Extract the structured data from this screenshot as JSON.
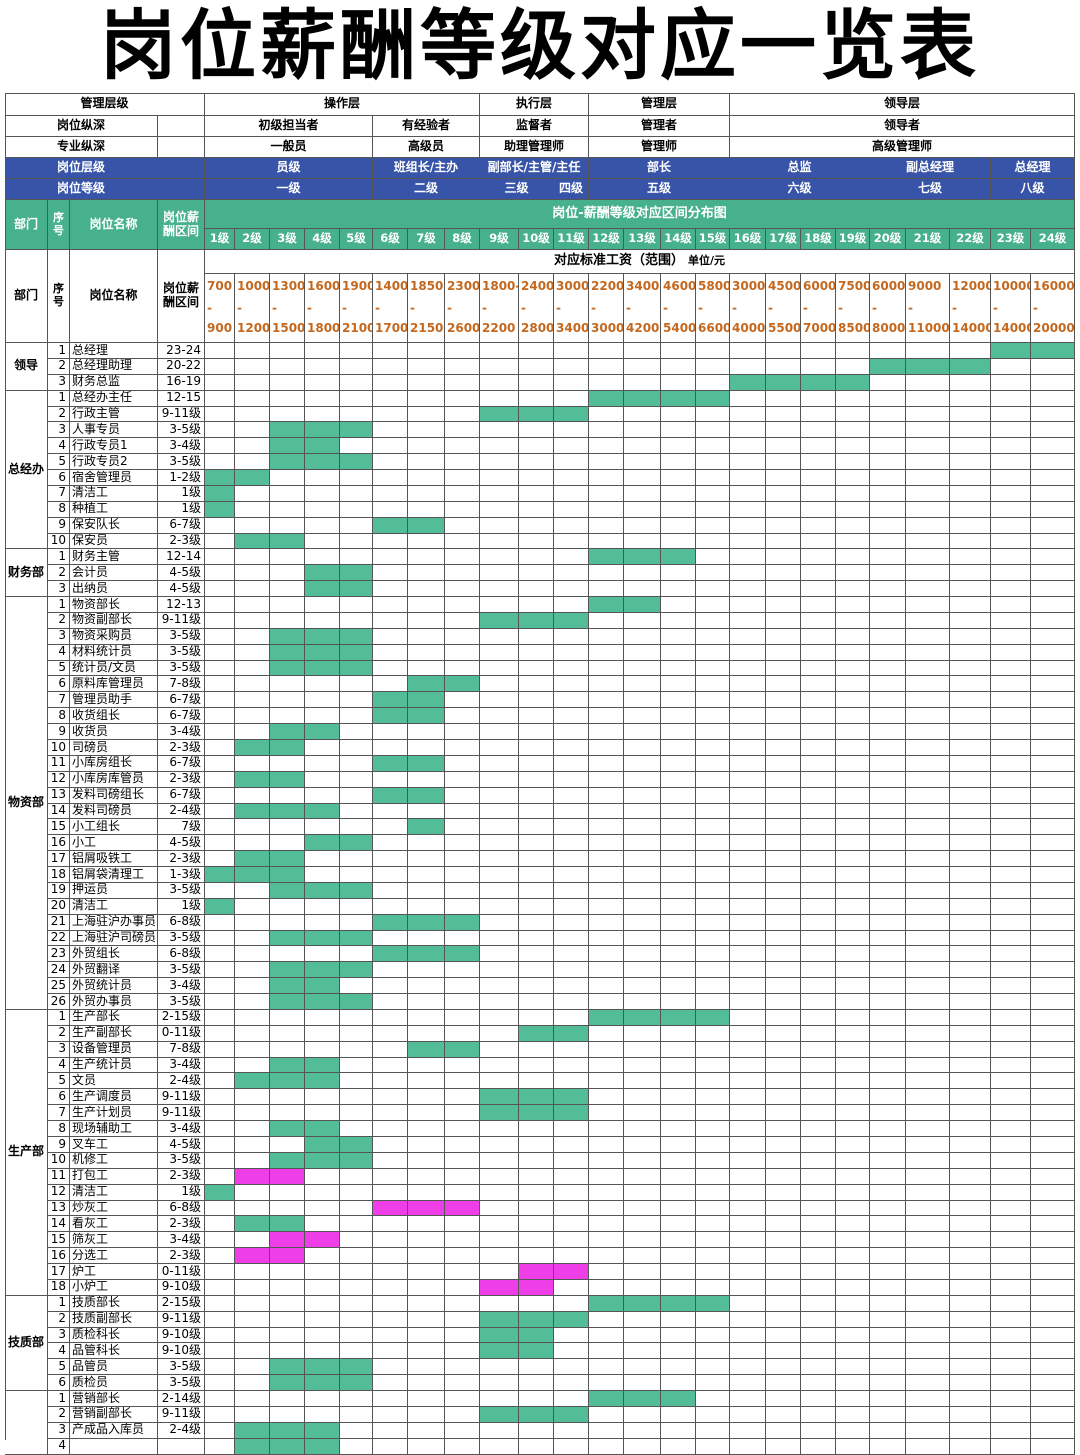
{
  "title": "岗位薪酬等级对应一览表",
  "header": {
    "r1": {
      "label": "管理层级",
      "groups": [
        "操作层",
        "执行层",
        "管理层",
        "领导层"
      ]
    },
    "r2": {
      "label": "岗位纵深",
      "groups": [
        "初级担当者",
        "有经验者",
        "监督者",
        "管理者",
        "领导者"
      ]
    },
    "r3": {
      "label": "专业纵深",
      "groups": [
        "一般员",
        "高级员",
        "助理管理师",
        "管理师",
        "高级管理师"
      ]
    },
    "r4": {
      "label": "岗位层级",
      "groups": [
        "员级",
        "班组长/主办",
        "副部长/主管/主任",
        "部长",
        "总监",
        "副总经理",
        "总经理"
      ]
    },
    "r5": {
      "label": "岗位等级",
      "groups": [
        "一级",
        "二级",
        "三级",
        "四级",
        "五级",
        "六级",
        "七级",
        "八级"
      ]
    }
  },
  "band": {
    "dept": "部门",
    "seq": "序号",
    "name": "岗位名称",
    "range": "岗位薪酬区间",
    "chart_title": "岗位-薪酬等级对应区间分布图",
    "grades": [
      "1级",
      "2级",
      "3级",
      "4级",
      "5级",
      "6级",
      "7级",
      "8级",
      "9级",
      "10级",
      "11级",
      "12级",
      "13级",
      "14级",
      "15级",
      "16级",
      "17级",
      "18级",
      "19级",
      "20级",
      "21级",
      "22级",
      "23级",
      "24级"
    ]
  },
  "wage": {
    "label": "对应标准工资（范围）",
    "unit": "单位/元",
    "ranges": [
      [
        "700",
        "900"
      ],
      [
        "1000",
        "1200"
      ],
      [
        "1300",
        "1500"
      ],
      [
        "1600",
        "1800"
      ],
      [
        "1900",
        "2100"
      ],
      [
        "1400",
        "1700"
      ],
      [
        "1850-",
        "2150"
      ],
      [
        "2300",
        "2600"
      ],
      [
        "1800-",
        "2200"
      ],
      [
        "2400",
        "2800"
      ],
      [
        "3000",
        "3400"
      ],
      [
        "2200",
        "3000"
      ],
      [
        "3400",
        "4200"
      ],
      [
        "4600",
        "5400"
      ],
      [
        "5800",
        "6600"
      ],
      [
        "3000",
        "4000"
      ],
      [
        "4500",
        "5500"
      ],
      [
        "6000",
        "7000"
      ],
      [
        "7500",
        "8500"
      ],
      [
        "6000",
        "8000"
      ],
      [
        "9000",
        "11000"
      ],
      [
        "12000",
        "14000"
      ],
      [
        "10000",
        "14000"
      ],
      [
        "16000",
        "20000"
      ]
    ]
  },
  "departments": [
    {
      "name": "领导",
      "rows": [
        {
          "seq": "1",
          "name": "总经理",
          "range": "23-24",
          "from": 23,
          "to": 24,
          "color": "teal"
        },
        {
          "seq": "2",
          "name": "总经理助理",
          "range": "20-22",
          "from": 20,
          "to": 22,
          "color": "teal"
        },
        {
          "seq": "3",
          "name": "财务总监",
          "range": "16-19",
          "from": 16,
          "to": 19,
          "color": "teal"
        }
      ]
    },
    {
      "name": "总经办",
      "rows": [
        {
          "seq": "1",
          "name": "总经办主任",
          "range": "12-15",
          "from": 12,
          "to": 15,
          "color": "teal"
        },
        {
          "seq": "2",
          "name": "行政主管",
          "range": "9-11级",
          "from": 9,
          "to": 11,
          "color": "teal"
        },
        {
          "seq": "3",
          "name": "人事专员",
          "range": "3-5级",
          "from": 3,
          "to": 5,
          "color": "teal"
        },
        {
          "seq": "4",
          "name": "行政专员1",
          "range": "3-4级",
          "from": 3,
          "to": 4,
          "color": "teal"
        },
        {
          "seq": "5",
          "name": "行政专员2",
          "range": "3-5级",
          "from": 3,
          "to": 5,
          "color": "teal"
        },
        {
          "seq": "6",
          "name": "宿舍管理员",
          "range": "1-2级",
          "from": 1,
          "to": 2,
          "color": "teal"
        },
        {
          "seq": "7",
          "name": "清洁工",
          "range": "1级",
          "from": 1,
          "to": 1,
          "color": "teal"
        },
        {
          "seq": "8",
          "name": "种植工",
          "range": "1级",
          "from": 1,
          "to": 1,
          "color": "teal"
        },
        {
          "seq": "9",
          "name": "保安队长",
          "range": "6-7级",
          "from": 6,
          "to": 7,
          "color": "teal"
        },
        {
          "seq": "10",
          "name": "保安员",
          "range": "2-3级",
          "from": 2,
          "to": 3,
          "color": "teal"
        }
      ]
    },
    {
      "name": "财务部",
      "rows": [
        {
          "seq": "1",
          "name": "财务主管",
          "range": "12-14",
          "from": 12,
          "to": 14,
          "color": "teal"
        },
        {
          "seq": "2",
          "name": "会计员",
          "range": "4-5级",
          "from": 4,
          "to": 5,
          "color": "teal"
        },
        {
          "seq": "3",
          "name": "出纳员",
          "range": "4-5级",
          "from": 4,
          "to": 5,
          "color": "teal"
        }
      ]
    },
    {
      "name": "物资部",
      "rows": [
        {
          "seq": "1",
          "name": "物资部长",
          "range": "12-13",
          "from": 12,
          "to": 13,
          "color": "teal"
        },
        {
          "seq": "2",
          "name": "物资副部长",
          "range": "9-11级",
          "from": 9,
          "to": 11,
          "color": "teal"
        },
        {
          "seq": "3",
          "name": "物资采购员",
          "range": "3-5级",
          "from": 3,
          "to": 5,
          "color": "teal"
        },
        {
          "seq": "4",
          "name": "材料统计员",
          "range": "3-5级",
          "from": 3,
          "to": 5,
          "color": "teal"
        },
        {
          "seq": "5",
          "name": "统计员/文员",
          "range": "3-5级",
          "from": 3,
          "to": 5,
          "color": "teal"
        },
        {
          "seq": "6",
          "name": "原料库管理员",
          "range": "7-8级",
          "from": 7,
          "to": 8,
          "color": "teal"
        },
        {
          "seq": "7",
          "name": "管理员助手",
          "range": "6-7级",
          "from": 6,
          "to": 7,
          "color": "teal"
        },
        {
          "seq": "8",
          "name": "收货组长",
          "range": "6-7级",
          "from": 6,
          "to": 7,
          "color": "teal"
        },
        {
          "seq": "9",
          "name": "收货员",
          "range": "3-4级",
          "from": 3,
          "to": 4,
          "color": "teal"
        },
        {
          "seq": "10",
          "name": "司磅员",
          "range": "2-3级",
          "from": 2,
          "to": 3,
          "color": "teal"
        },
        {
          "seq": "11",
          "name": "小库房组长",
          "range": "6-7级",
          "from": 6,
          "to": 7,
          "color": "teal"
        },
        {
          "seq": "12",
          "name": "小库房库管员",
          "range": "2-3级",
          "from": 2,
          "to": 3,
          "color": "teal"
        },
        {
          "seq": "13",
          "name": "发料司磅组长",
          "range": "6-7级",
          "from": 6,
          "to": 7,
          "color": "teal"
        },
        {
          "seq": "14",
          "name": "发料司磅员",
          "range": "2-4级",
          "from": 2,
          "to": 4,
          "color": "teal"
        },
        {
          "seq": "15",
          "name": "小工组长",
          "range": "7级",
          "from": 7,
          "to": 7,
          "color": "teal"
        },
        {
          "seq": "16",
          "name": "小工",
          "range": "4-5级",
          "from": 4,
          "to": 5,
          "color": "teal"
        },
        {
          "seq": "17",
          "name": "铝屑吸铁工",
          "range": "2-3级",
          "from": 2,
          "to": 3,
          "color": "teal"
        },
        {
          "seq": "18",
          "name": "铝屑袋清理工",
          "range": "1-3级",
          "from": 1,
          "to": 3,
          "color": "teal"
        },
        {
          "seq": "19",
          "name": "押运员",
          "range": "3-5级",
          "from": 3,
          "to": 5,
          "color": "teal"
        },
        {
          "seq": "20",
          "name": "清洁工",
          "range": "1级",
          "from": 1,
          "to": 1,
          "color": "teal"
        },
        {
          "seq": "21",
          "name": "上海驻沪办事员",
          "range": "6-8级",
          "from": 6,
          "to": 8,
          "color": "teal"
        },
        {
          "seq": "22",
          "name": "上海驻沪司磅员",
          "range": "3-5级",
          "from": 3,
          "to": 5,
          "color": "teal"
        },
        {
          "seq": "23",
          "name": "外贸组长",
          "range": "6-8级",
          "from": 6,
          "to": 8,
          "color": "teal"
        },
        {
          "seq": "24",
          "name": "外贸翻译",
          "range": "3-5级",
          "from": 3,
          "to": 5,
          "color": "teal"
        },
        {
          "seq": "25",
          "name": "外贸统计员",
          "range": "3-4级",
          "from": 3,
          "to": 4,
          "color": "teal"
        },
        {
          "seq": "26",
          "name": "外贸办事员",
          "range": "3-5级",
          "from": 3,
          "to": 5,
          "color": "teal"
        }
      ]
    },
    {
      "name": "生产部",
      "rows": [
        {
          "seq": "1",
          "name": "生产部长",
          "range": "2-15级",
          "from": 12,
          "to": 15,
          "color": "teal"
        },
        {
          "seq": "2",
          "name": "生产副部长",
          "range": "0-11级",
          "from": 10,
          "to": 11,
          "color": "teal"
        },
        {
          "seq": "3",
          "name": "设备管理员",
          "range": "7-8级",
          "from": 7,
          "to": 8,
          "color": "teal"
        },
        {
          "seq": "4",
          "name": "生产统计员",
          "range": "3-4级",
          "from": 3,
          "to": 4,
          "color": "teal"
        },
        {
          "seq": "5",
          "name": "文员",
          "range": "2-4级",
          "from": 2,
          "to": 4,
          "color": "teal"
        },
        {
          "seq": "6",
          "name": "生产调度员",
          "range": "9-11级",
          "from": 9,
          "to": 11,
          "color": "teal"
        },
        {
          "seq": "7",
          "name": "生产计划员",
          "range": "9-11级",
          "from": 9,
          "to": 11,
          "color": "teal"
        },
        {
          "seq": "8",
          "name": "现场辅助工",
          "range": "3-4级",
          "from": 3,
          "to": 4,
          "color": "teal"
        },
        {
          "seq": "9",
          "name": "叉车工",
          "range": "4-5级",
          "from": 4,
          "to": 5,
          "color": "teal"
        },
        {
          "seq": "10",
          "name": "机修工",
          "range": "3-5级",
          "from": 3,
          "to": 5,
          "color": "teal"
        },
        {
          "seq": "11",
          "name": "打包工",
          "range": "2-3级",
          "from": 2,
          "to": 3,
          "color": "pink"
        },
        {
          "seq": "12",
          "name": "清洁工",
          "range": "1级",
          "from": 1,
          "to": 1,
          "color": "teal"
        },
        {
          "seq": "13",
          "name": "炒灰工",
          "range": "6-8级",
          "from": 6,
          "to": 8,
          "color": "pink"
        },
        {
          "seq": "14",
          "name": "看灰工",
          "range": "2-3级",
          "from": 2,
          "to": 3,
          "color": "teal"
        },
        {
          "seq": "15",
          "name": "筛灰工",
          "range": "3-4级",
          "from": 3,
          "to": 4,
          "color": "pink"
        },
        {
          "seq": "16",
          "name": "分选工",
          "range": "2-3级",
          "from": 2,
          "to": 3,
          "color": "pink"
        },
        {
          "seq": "17",
          "name": "炉工",
          "range": "0-11级",
          "from": 10,
          "to": 11,
          "color": "pink"
        },
        {
          "seq": "18",
          "name": "小炉工",
          "range": "9-10级",
          "from": 9,
          "to": 10,
          "color": "pink"
        }
      ]
    },
    {
      "name": "技质部",
      "rows": [
        {
          "seq": "1",
          "name": "技质部长",
          "range": "2-15级",
          "from": 12,
          "to": 15,
          "color": "teal"
        },
        {
          "seq": "2",
          "name": "技质副部长",
          "range": "9-11级",
          "from": 9,
          "to": 11,
          "color": "teal"
        },
        {
          "seq": "3",
          "name": "质检科长",
          "range": "9-10级",
          "from": 9,
          "to": 10,
          "color": "teal"
        },
        {
          "seq": "4",
          "name": "品管科长",
          "range": "9-10级",
          "from": 9,
          "to": 10,
          "color": "teal"
        },
        {
          "seq": "5",
          "name": "品管员",
          "range": "3-5级",
          "from": 3,
          "to": 5,
          "color": "teal"
        },
        {
          "seq": "6",
          "name": "质检员",
          "range": "3-5级",
          "from": 3,
          "to": 5,
          "color": "teal"
        }
      ]
    },
    {
      "name": "",
      "rows": [
        {
          "seq": "1",
          "name": "营销部长",
          "range": "2-14级",
          "from": 12,
          "to": 14,
          "color": "teal"
        },
        {
          "seq": "2",
          "name": "营销副部长",
          "range": "9-11级",
          "from": 9,
          "to": 11,
          "color": "teal"
        },
        {
          "seq": "3",
          "name": "产成品入库员",
          "range": "2-4级",
          "from": 2,
          "to": 4,
          "color": "teal"
        },
        {
          "seq": "4",
          "name": "",
          "range": "",
          "from": 2,
          "to": 4,
          "color": "teal"
        }
      ]
    }
  ],
  "colors": {
    "header_blue": "#3754a8",
    "header_green": "#47b08d",
    "bar_teal": "#52bd97",
    "bar_pink": "#ee3ee8",
    "wage_orange": "#c5681e"
  }
}
